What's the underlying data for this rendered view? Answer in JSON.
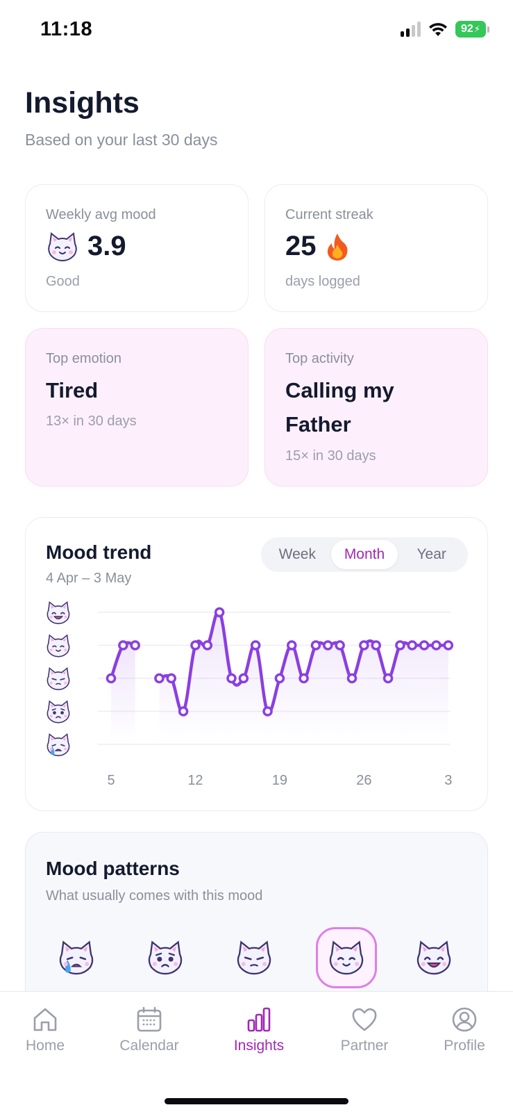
{
  "status": {
    "time": "11:18",
    "battery": "92"
  },
  "header": {
    "title": "Insights",
    "subtitle": "Based on your last 30 days"
  },
  "cards": {
    "weekly_mood": {
      "label": "Weekly avg mood",
      "value": "3.9",
      "caption": "Good",
      "icon": "cat-smile-icon"
    },
    "streak": {
      "label": "Current streak",
      "value": "25",
      "caption": "days logged",
      "icon": "flame-icon"
    },
    "top_emotion": {
      "label": "Top emotion",
      "value": "Tired",
      "caption": "13× in 30 days"
    },
    "top_activity": {
      "label": "Top activity",
      "value": "Calling my Father",
      "caption": "15× in 30 days"
    }
  },
  "trend": {
    "title": "Mood trend",
    "range": "4 Apr – 3 May",
    "segments": [
      "Week",
      "Month",
      "Year"
    ],
    "active_segment": "Month"
  },
  "chart_data": {
    "type": "line",
    "x_ticks": [
      "5",
      "12",
      "19",
      "26",
      "3"
    ],
    "y_levels": [
      "cat-crying",
      "cat-sad",
      "cat-meh",
      "cat-content",
      "cat-happy"
    ],
    "ylim": [
      1,
      5
    ],
    "grid": true,
    "series": [
      {
        "color": "#8b3fe0",
        "points": [
          [
            5,
            3
          ],
          [
            6,
            4
          ],
          [
            7,
            4
          ],
          [
            9,
            3
          ],
          [
            10,
            3
          ],
          [
            11,
            2
          ],
          [
            12,
            4
          ],
          [
            13,
            4
          ],
          [
            14,
            5
          ],
          [
            15,
            3
          ],
          [
            16,
            3
          ],
          [
            17,
            4
          ],
          [
            18,
            2
          ],
          [
            19,
            3
          ],
          [
            20,
            4
          ],
          [
            21,
            3
          ],
          [
            22,
            4
          ],
          [
            23,
            4
          ],
          [
            24,
            4
          ],
          [
            25,
            3
          ],
          [
            26,
            4
          ],
          [
            27,
            4
          ],
          [
            28,
            3
          ],
          [
            29,
            4
          ],
          [
            30,
            4
          ],
          [
            31,
            4
          ],
          [
            32,
            4
          ],
          [
            33,
            4
          ]
        ]
      }
    ]
  },
  "patterns": {
    "title": "Mood patterns",
    "subtitle": "What usually comes with this mood",
    "moods": [
      "cat-crying-icon",
      "cat-sad-icon",
      "cat-meh-icon",
      "cat-content-icon",
      "cat-happy-icon"
    ],
    "selected": "cat-content-icon"
  },
  "tabs": [
    {
      "label": "Home",
      "icon": "home-icon"
    },
    {
      "label": "Calendar",
      "icon": "calendar-icon"
    },
    {
      "label": "Insights",
      "icon": "bar-chart-icon",
      "active": true
    },
    {
      "label": "Partner",
      "icon": "heart-icon"
    },
    {
      "label": "Profile",
      "icon": "user-circle-icon"
    }
  ],
  "colors": {
    "accent": "#a228b8",
    "line": "#8b3fe0",
    "pink_card": "#fdf0fc"
  }
}
